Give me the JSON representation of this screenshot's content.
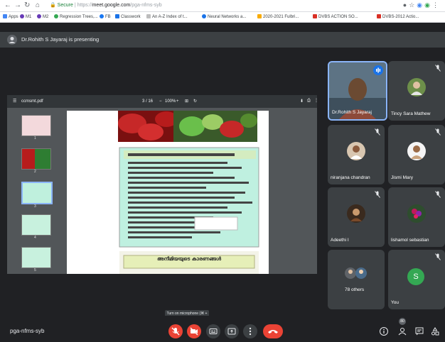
{
  "browser": {
    "secure_label": "Secure",
    "url_prefix": "https://",
    "url_domain": "meet.google.com",
    "url_path": "/pga-nfms-syb"
  },
  "bookmarks": [
    {
      "label": "Apps"
    },
    {
      "label": "M1"
    },
    {
      "label": "M2"
    },
    {
      "label": "Regression Trees,..."
    },
    {
      "label": "FB"
    },
    {
      "label": "Classwork"
    },
    {
      "label": "An A-Z Index of t..."
    },
    {
      "label": "Neural Networks a..."
    },
    {
      "label": "2020-2021 Fulbri..."
    },
    {
      "label": "DVBS ACTION SO..."
    },
    {
      "label": "DVBS-2012 Actio..."
    }
  ],
  "presenter_banner": "Dr.Rohith S Jayaraj is presenting",
  "pdf": {
    "filename": "ccmsmt.pdf",
    "page_indicator": "3 / 16",
    "zoom": "100%",
    "thumb_numbers": [
      "1",
      "2",
      "3",
      "4",
      "5"
    ],
    "section_heading": "അനീമിയയുടെ കാരണങ്ങൾ"
  },
  "participants": [
    {
      "name": "Dr.Rohith S Jayaraj",
      "active": true
    },
    {
      "name": "Tincy Sara Mathew"
    },
    {
      "name": "niranjana chandran"
    },
    {
      "name": "Jismi Mary"
    },
    {
      "name": "Adeethi I"
    },
    {
      "name": "lishamol sebastian"
    },
    {
      "name": "78 others"
    },
    {
      "name": "You",
      "avatar_letter": "S"
    }
  ],
  "meeting_code": "pga-nfms-syb",
  "tooltip": "Turn on microphone (⌘ + d)",
  "people_count": "80",
  "colors": {
    "meet_bg": "#202124",
    "tile_bg": "#3c4043",
    "end_call": "#ea4335",
    "active_border": "#8ab4f8",
    "you_avatar": "#34a853"
  }
}
